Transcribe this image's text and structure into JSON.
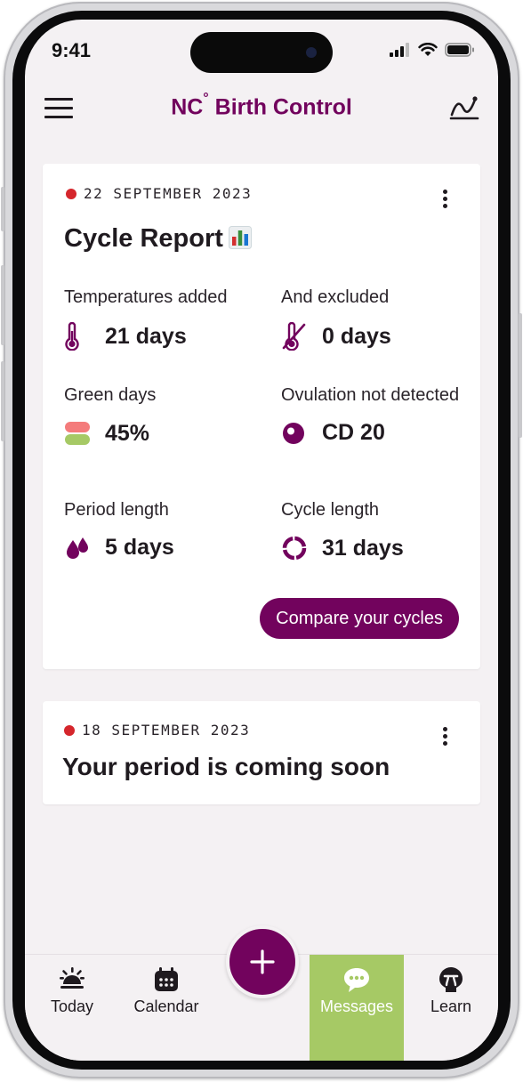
{
  "status_bar": {
    "time": "9:41"
  },
  "header": {
    "brand_prefix": "NC",
    "brand_degree": "°",
    "brand_name": " Birth Control"
  },
  "cycle_report": {
    "date": "22 SEPTEMBER 2023",
    "title": "Cycle Report",
    "stats": {
      "temperatures_added": {
        "label": "Temperatures added",
        "value": "21 days"
      },
      "excluded": {
        "label": "And excluded",
        "value": "0 days"
      },
      "green_days": {
        "label": "Green days",
        "value": "45%"
      },
      "ovulation": {
        "label": "Ovulation not detected",
        "value": "CD 20"
      },
      "period_length": {
        "label": "Period length",
        "value": "5 days"
      },
      "cycle_length": {
        "label": "Cycle length",
        "value": "31 days"
      }
    },
    "compare_label": "Compare your cycles"
  },
  "period_card": {
    "date": "18 SEPTEMBER 2023",
    "title": "Your period is coming soon"
  },
  "nav": {
    "items": [
      {
        "label": "Today",
        "icon": "sunrise-icon"
      },
      {
        "label": "Calendar",
        "icon": "calendar-icon"
      },
      {
        "label": "Messages",
        "icon": "chat-bubble-icon",
        "active": true
      },
      {
        "label": "Learn",
        "icon": "learn-icon"
      }
    ],
    "fab_icon": "plus-icon"
  },
  "colors": {
    "brand": "#72035d",
    "accent_green": "#a6c965",
    "alert_red": "#d5262c",
    "green_day": "#a6c965",
    "red_day": "#f47b7b"
  }
}
